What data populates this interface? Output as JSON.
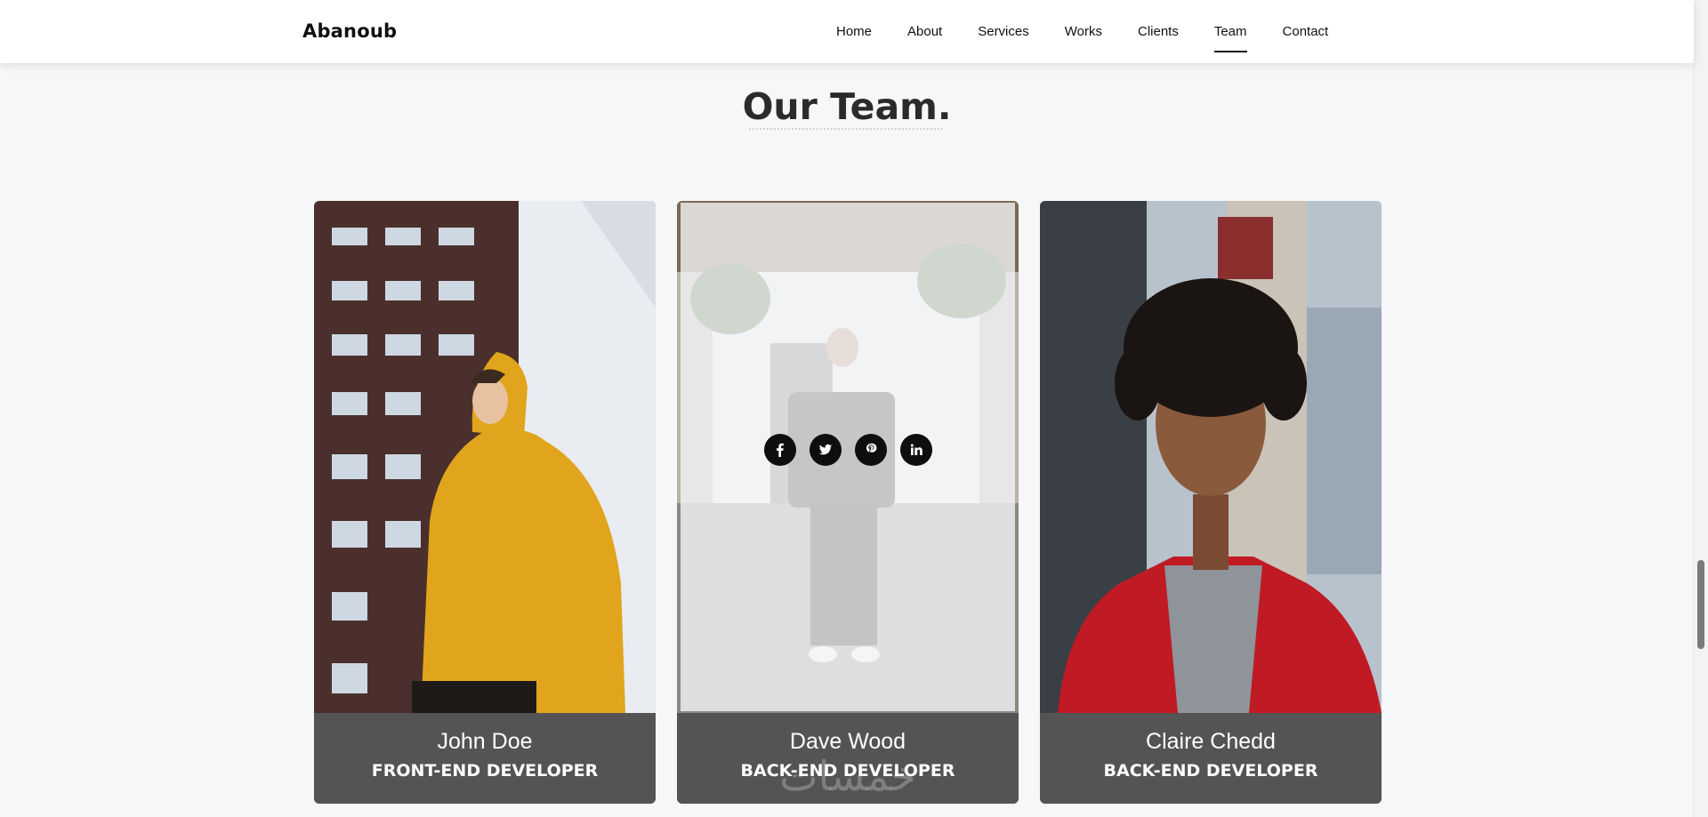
{
  "navbar": {
    "brand": "Abanoub",
    "links": [
      {
        "label": "Home"
      },
      {
        "label": "About"
      },
      {
        "label": "Services"
      },
      {
        "label": "Works"
      },
      {
        "label": "Clients"
      },
      {
        "label": "Team",
        "active": true
      },
      {
        "label": "Contact"
      }
    ]
  },
  "team": {
    "title": "Our Team.",
    "members": [
      {
        "name": "John Doe",
        "role": "FRONT-END DEVELOPER"
      },
      {
        "name": "Dave Wood",
        "role": "BACK-END DEVELOPER",
        "socials": [
          "facebook-icon",
          "twitter-icon",
          "pinterest-icon",
          "linkedin-icon"
        ]
      },
      {
        "name": "Claire Chedd",
        "role": "BACK-END DEVELOPER"
      }
    ]
  },
  "colors": {
    "page_bg": "#f6f7f9",
    "card_info_bg": "#545454",
    "hoodie_yellow": "#e0a51c",
    "jacket_red": "#c01a25"
  }
}
